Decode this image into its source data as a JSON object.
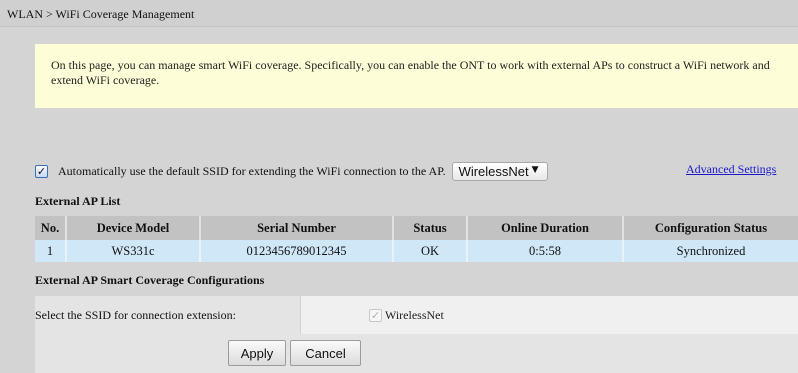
{
  "breadcrumb": "WLAN > WiFi Coverage Management",
  "info_text": "On this page, you can manage smart WiFi coverage. Specifically, you can enable the ONT to work with external APs to construct a WiFi network and extend WiFi coverage.",
  "auto_ssid": {
    "checked": true,
    "check_glyph": "✓",
    "label": "Automatically use the default SSID for extending the WiFi connection to the AP.",
    "select_value": "WirelessNet",
    "select_arrow": "▼"
  },
  "advanced_settings_link": "Advanced Settings",
  "external_ap_list": {
    "title": "External AP List",
    "columns": [
      "No.",
      "Device Model",
      "Serial Number",
      "Status",
      "Online Duration",
      "Configuration Status"
    ],
    "rows": [
      [
        "1",
        "WS331c",
        "0123456789012345",
        "OK",
        "0:5:58",
        "Synchronized"
      ]
    ]
  },
  "smart_coverage": {
    "title": "External AP Smart Coverage Configurations",
    "ssid_label": "Select the SSID for connection extension:",
    "ssid_option": "WirelessNet",
    "ssid_option_checked": true,
    "check_glyph": "✓"
  },
  "buttons": {
    "apply": "Apply",
    "cancel": "Cancel"
  },
  "colors": {
    "info_background": "#fdfdd8",
    "table_header": "#c2c2c2",
    "table_row_selected": "#cfe7f7",
    "link": "#1a1acc"
  }
}
